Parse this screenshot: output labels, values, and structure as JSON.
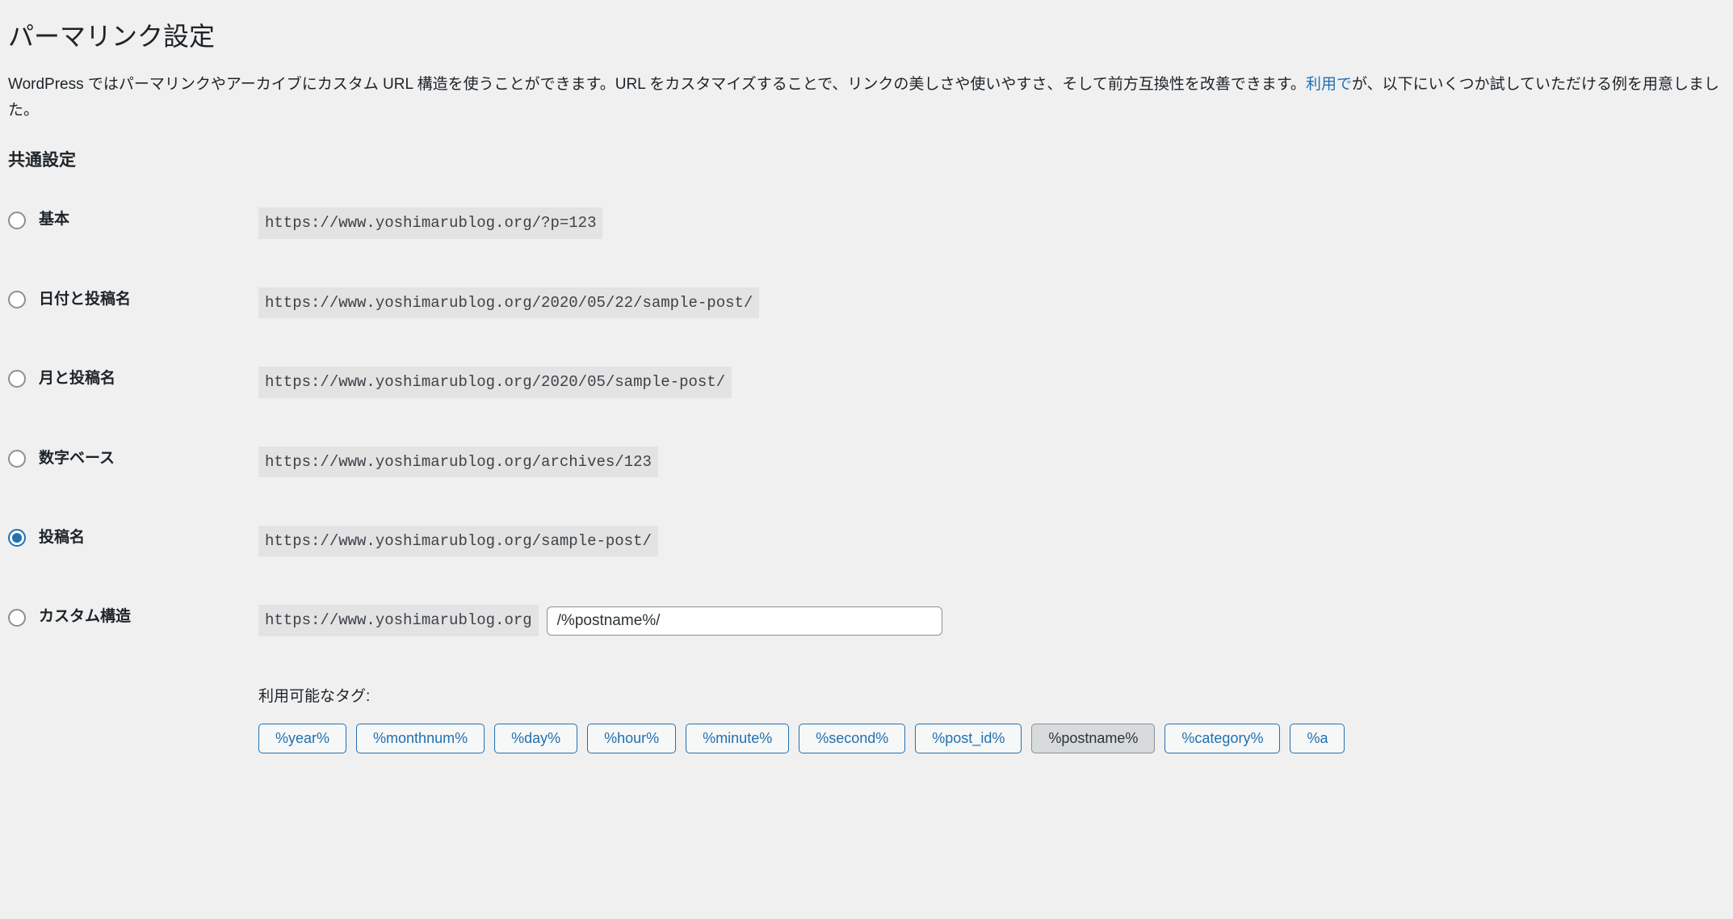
{
  "page": {
    "title": "パーマリンク設定",
    "description_pre": "WordPress ではパーマリンクやアーカイブにカスタム URL 構造を使うことができます。URL をカスタマイズすることで、リンクの美しさや使いやすさ、そして前方互換性を改善できます。",
    "description_link": "利用で",
    "description_post": "が、以下にいくつか試していただける例を用意しました。",
    "section_heading": "共通設定"
  },
  "options": {
    "plain": {
      "label": "基本",
      "example": "https://www.yoshimarublog.org/?p=123"
    },
    "day_name": {
      "label": "日付と投稿名",
      "example": "https://www.yoshimarublog.org/2020/05/22/sample-post/"
    },
    "month_name": {
      "label": "月と投稿名",
      "example": "https://www.yoshimarublog.org/2020/05/sample-post/"
    },
    "numeric": {
      "label": "数字ベース",
      "example": "https://www.yoshimarublog.org/archives/123"
    },
    "post_name": {
      "label": "投稿名",
      "example": "https://www.yoshimarublog.org/sample-post/"
    },
    "custom": {
      "label": "カスタム構造",
      "base_url": "https://www.yoshimarublog.org",
      "value": "/%postname%/"
    }
  },
  "tags": {
    "label": "利用可能なタグ:",
    "items": [
      "%year%",
      "%monthnum%",
      "%day%",
      "%hour%",
      "%minute%",
      "%second%",
      "%post_id%",
      "%postname%",
      "%category%",
      "%a"
    ]
  },
  "selected": "post_name",
  "active_tag": "%postname%"
}
